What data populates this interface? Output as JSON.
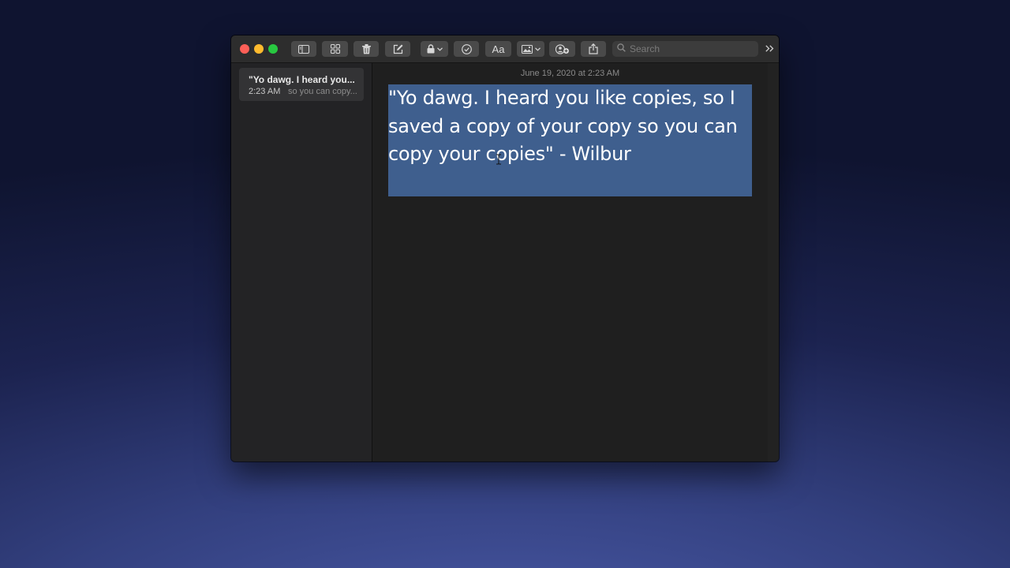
{
  "window": {
    "toolbar": {
      "buttons": [
        {
          "name": "sidebar-toggle-button",
          "icon": "sidebar-icon"
        },
        {
          "name": "gallery-view-button",
          "icon": "grid-icon"
        },
        {
          "name": "delete-button",
          "icon": "trash-icon"
        },
        {
          "name": "compose-button",
          "icon": "compose-icon"
        },
        {
          "name": "lock-button",
          "icon": "lock-icon"
        },
        {
          "name": "checklist-button",
          "icon": "checkmark-circle-icon"
        },
        {
          "name": "format-button",
          "icon": "text-format-icon",
          "label": "Aa"
        },
        {
          "name": "media-button",
          "icon": "photo-icon"
        },
        {
          "name": "collaborate-button",
          "icon": "add-people-icon"
        },
        {
          "name": "share-button",
          "icon": "share-icon"
        }
      ],
      "search": {
        "placeholder": "Search",
        "value": ""
      }
    },
    "sidebar": {
      "notes": [
        {
          "title": "\"Yo dawg. I heard you...",
          "time": "2:23 AM",
          "preview": "so you can copy..."
        }
      ]
    },
    "editor": {
      "date": "June 19, 2020 at 2:23 AM",
      "body": "\"Yo dawg. I heard you like copies, so I saved a copy of your copy so you can copy your copies\" - Wilbur"
    }
  },
  "colors": {
    "selection": "#3f5f8e",
    "close": "#fd5f57",
    "minimize": "#febb2e",
    "zoom": "#28c840"
  }
}
